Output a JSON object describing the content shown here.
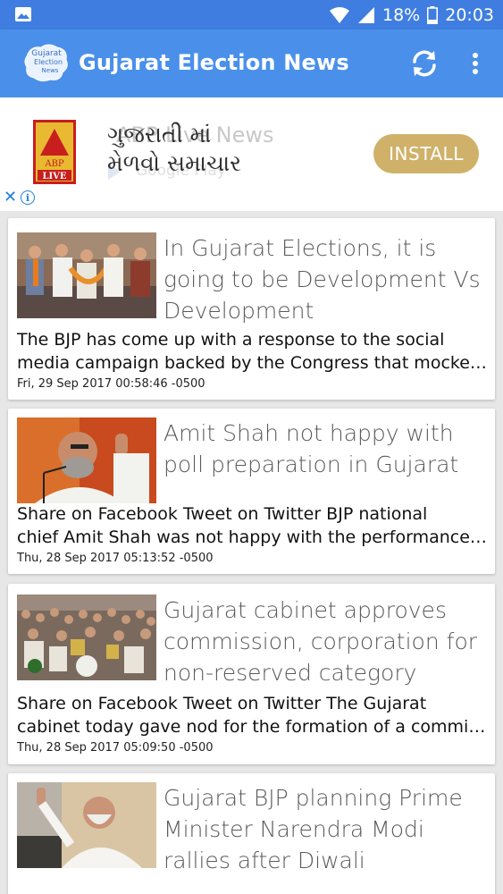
{
  "status_bar": {
    "battery": "18%",
    "time": "20:03",
    "icons": [
      "image-icon",
      "wifi-icon",
      "signal-icon",
      "battery-icon"
    ]
  },
  "app_bar": {
    "logo_text_top": "Gujarat",
    "logo_text_mid": "Election",
    "logo_text_bot": "News",
    "title": "Gujarat Election News",
    "icons": [
      "refresh-icon",
      "overflow-menu-icon"
    ]
  },
  "ad": {
    "logo_top": "ABP",
    "logo_bottom": "LIVE",
    "ghost_text": "ABP Live News",
    "ghost_store": "Google Play",
    "headline_line1": "ગુજરાતી માં",
    "headline_line2": "મેળવો સમાચાર",
    "install_label": "INSTALL",
    "close_label": "✕",
    "info_label": "i",
    "colors": {
      "install": "#cfb169",
      "adchoice": "#1f7fd8"
    }
  },
  "articles": [
    {
      "title": "In Gujarat Elections, it is going to be Development Vs Development",
      "desc_line1": "The BJP has come up with a response to the social",
      "desc_line2": "media campaign backed by the Congress that mocked the Gujarat model",
      "date": "Fri, 29 Sep 2017 00:58:46 -0500"
    },
    {
      "title": "Amit Shah not happy with poll preparation in Gujarat",
      "desc_line1": "Share on Facebook  Tweet on Twitter     BJP national",
      "desc_line2": "chief Amit Shah was not happy with the performance of the state unit",
      "date": "Thu, 28 Sep 2017 05:13:52 -0500"
    },
    {
      "title": "Gujarat cabinet approves commission, corporation for non-reserved category",
      "desc_line1": "Share on Facebook  Tweet on Twitter     The Gujarat",
      "desc_line2": "cabinet today gave nod for the formation of a commission and corporation",
      "date": "Thu, 28 Sep 2017 05:09:50 -0500"
    },
    {
      "title": "Gujarat BJP planning Prime Minister Narendra Modi rallies after Diwali",
      "desc_line1": "",
      "desc_line2": "",
      "date": ""
    }
  ],
  "colors": {
    "status_bar": "#3f7ee0",
    "app_bar": "#4a90ea",
    "background": "#e7e7e7"
  }
}
